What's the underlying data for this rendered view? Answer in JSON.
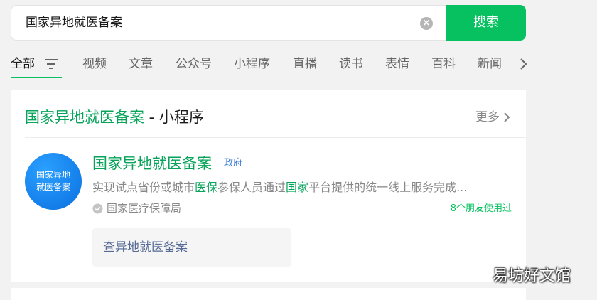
{
  "search": {
    "query": "国家异地就医备案",
    "clear_icon": "clear-circle-icon",
    "button_label": "搜索"
  },
  "tabs": [
    "全部",
    "视频",
    "文章",
    "公众号",
    "小程序",
    "直播",
    "读书",
    "表情",
    "百科",
    "新闻"
  ],
  "section": {
    "title_keyword": "国家异地就医备案",
    "title_rest": " - 小程序",
    "more_label": "更多"
  },
  "result": {
    "logo_line1": "国家异地",
    "logo_line2": "就医备案",
    "name": "国家异地就医备案",
    "tag": "政府",
    "desc_parts": [
      "实现试点省份或城市",
      "医保",
      "参保人员通过",
      "国家",
      "平台提供的统一线上服务完成..."
    ],
    "provider": "国家医疗保障局",
    "friends_used": "8个朋友使用过",
    "service_button": "查异地就医备案"
  },
  "watermark": "易坊好文馆",
  "colors": {
    "accent": "#07c160",
    "keyword": "#07a35a",
    "link": "#576b95",
    "tag": "#3a7bd5"
  }
}
